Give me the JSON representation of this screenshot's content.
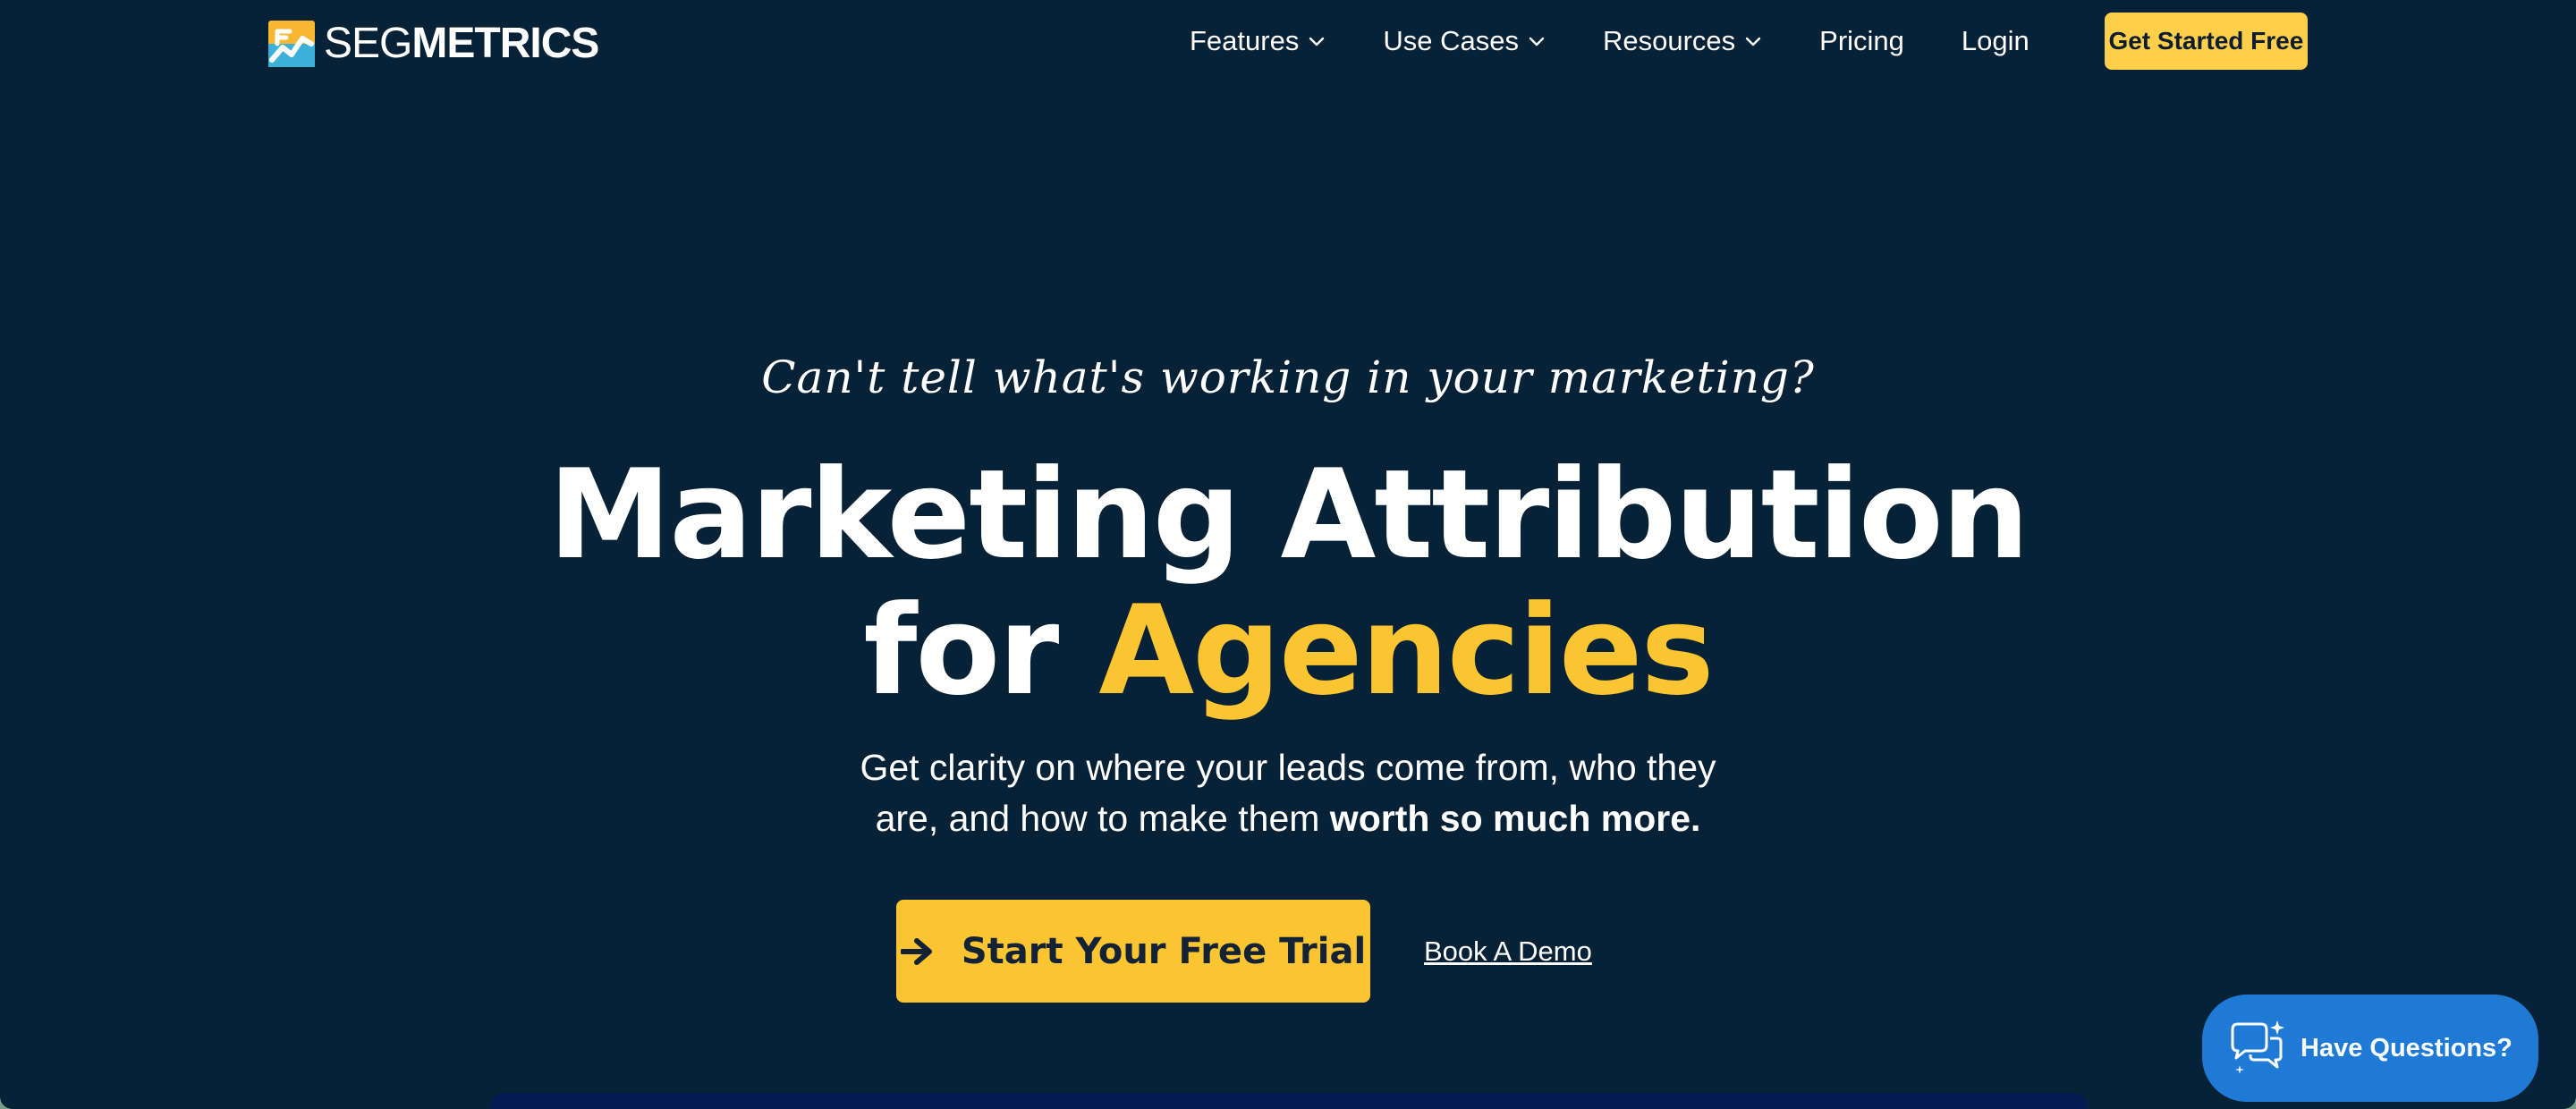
{
  "brand": {
    "name_light": "SEG",
    "name_bold": "METRICS",
    "logo_icon": "segmetrics-logo-icon",
    "colors": {
      "background": "#072136",
      "accent": "#fbc531",
      "chat": "#1f7ad6"
    }
  },
  "nav": {
    "items": [
      {
        "label": "Features",
        "has_dropdown": true
      },
      {
        "label": "Use Cases",
        "has_dropdown": true
      },
      {
        "label": "Resources",
        "has_dropdown": true
      },
      {
        "label": "Pricing",
        "has_dropdown": false
      },
      {
        "label": "Login",
        "has_dropdown": false
      }
    ],
    "cta_label": "Get Started Free",
    "dropdown_icon": "chevron-down-icon"
  },
  "hero": {
    "tagline": "Can't tell what's working in your marketing?",
    "headline_line1": "Marketing Attribution",
    "headline_for": "for ",
    "headline_accent": "Agencies",
    "sub_line1": "Get clarity on where your leads come from, who they",
    "sub_line2_plain": "are, and how to make them ",
    "sub_line2_bold": "worth so much more.",
    "primary_cta": "Start Your Free Trial",
    "primary_cta_icon": "arrow-right-icon",
    "secondary_cta": "Book A Demo"
  },
  "chat": {
    "label": "Have Questions?",
    "icon": "chat-bubbles-icon"
  }
}
